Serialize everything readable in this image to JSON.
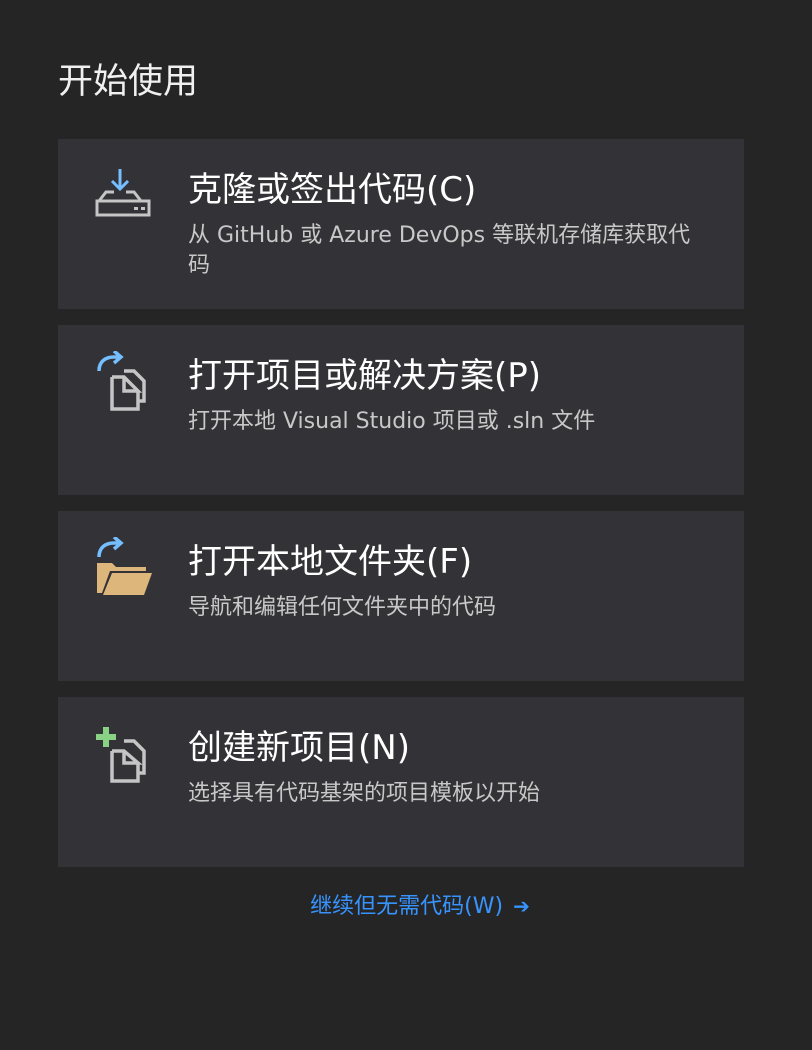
{
  "page": {
    "title": "开始使用"
  },
  "actions": [
    {
      "title": "克隆或签出代码(C)",
      "description": "从 GitHub 或 Azure DevOps 等联机存储库获取代码",
      "icon": "clone-download-icon"
    },
    {
      "title": "打开项目或解决方案(P)",
      "description": "打开本地 Visual Studio 项目或 .sln 文件",
      "icon": "open-project-icon"
    },
    {
      "title": "打开本地文件夹(F)",
      "description": "导航和编辑任何文件夹中的代码",
      "icon": "open-folder-icon"
    },
    {
      "title": "创建新项目(N)",
      "description": "选择具有代码基架的项目模板以开始",
      "icon": "new-project-icon"
    }
  ],
  "continue_link": {
    "label": "继续但无需代码(W)",
    "icon": "arrow-right-icon"
  },
  "colors": {
    "background": "#252526",
    "card": "#333337",
    "link": "#3794ff",
    "accent_blue": "#75beff",
    "folder": "#dcb67a",
    "plus_green": "#89d185"
  }
}
